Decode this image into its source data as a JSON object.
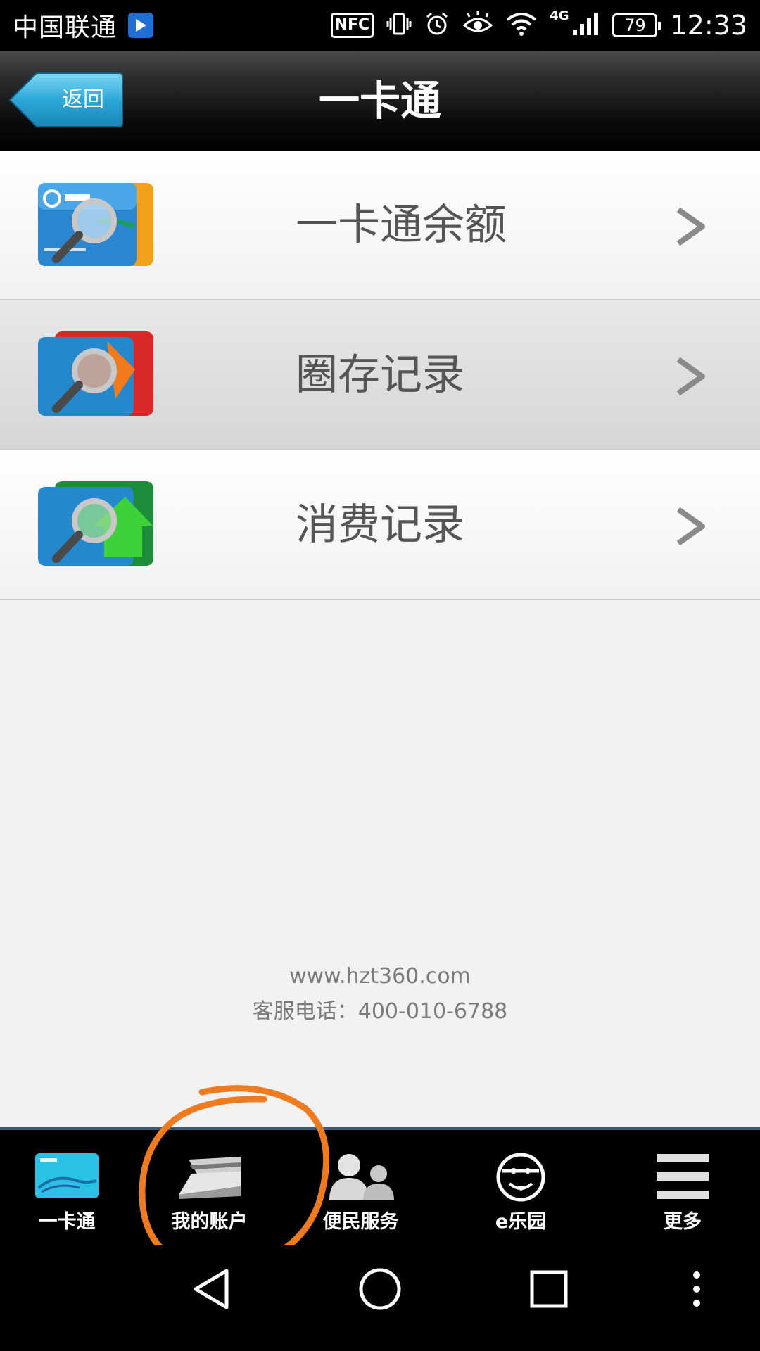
{
  "status_bar": {
    "carrier": "中国联通",
    "nfc": "NFC",
    "network": "4G",
    "battery": "79",
    "time": "12:33"
  },
  "header": {
    "back_label": "返回",
    "title": "一卡通"
  },
  "menu": [
    {
      "label": "一卡通余额",
      "icon": "card-balance-search-icon"
    },
    {
      "label": "圈存记录",
      "icon": "recharge-record-search-icon"
    },
    {
      "label": "消费记录",
      "icon": "consumption-record-search-icon"
    }
  ],
  "footer": {
    "website": "www.hzt360.com",
    "service_phone": "客服电话：400-010-6788"
  },
  "tabs": [
    {
      "label": "一卡通",
      "icon": "card-icon"
    },
    {
      "label": "我的账户",
      "icon": "wallet-icon"
    },
    {
      "label": "便民服务",
      "icon": "people-icon"
    },
    {
      "label": "e乐园",
      "icon": "smiley-icon"
    },
    {
      "label": "更多",
      "icon": "menu-icon"
    }
  ],
  "colors": {
    "back_button": "#2ba8d8",
    "highlight_circle": "#f07a1e",
    "tab_bar_border": "#3a5a78"
  }
}
